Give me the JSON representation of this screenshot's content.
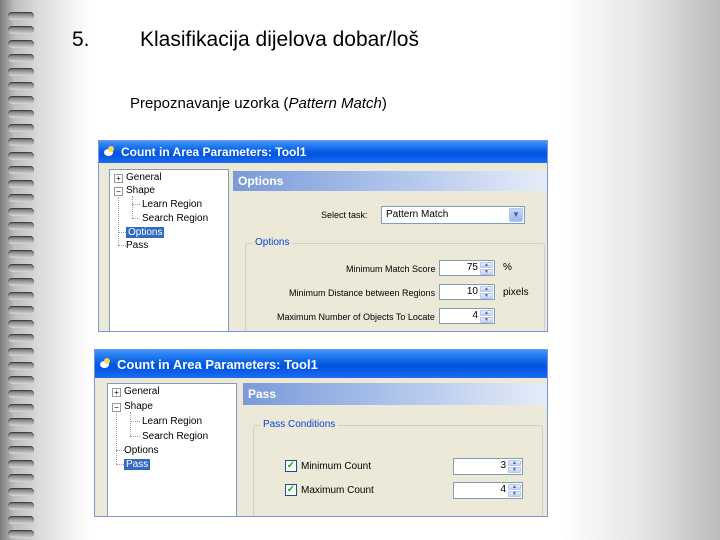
{
  "slide": {
    "number": "5.",
    "title": "Klasifikacija dijelova dobar/loš",
    "subtitle_prefix": "Prepoznavanje uzorka (",
    "subtitle_italic": "Pattern Match",
    "subtitle_suffix": ")"
  },
  "window1": {
    "title": "Count in Area Parameters: Tool1",
    "tree": {
      "general": "General",
      "shape": "Shape",
      "learn_region": "Learn Region",
      "search_region": "Search Region",
      "options": "Options",
      "pass": "Pass",
      "expand_glyph": "+",
      "collapse_glyph": "−"
    },
    "panel_title": "Options",
    "select_task_label": "Select task:",
    "select_task_value": "Pattern Match",
    "group_label": "Options",
    "fields": [
      {
        "label": "Minimum Match Score",
        "value": "75",
        "unit": "%"
      },
      {
        "label": "Minimum Distance between Regions",
        "value": "10",
        "unit": "pixels"
      },
      {
        "label": "Maximum Number of Objects To Locate",
        "value": "4",
        "unit": ""
      }
    ]
  },
  "window2": {
    "title": "Count in Area Parameters: Tool1",
    "tree": {
      "general": "General",
      "shape": "Shape",
      "learn_region": "Learn Region",
      "search_region": "Search Region",
      "options": "Options",
      "pass": "Pass",
      "expand_glyph": "+",
      "collapse_glyph": "−"
    },
    "panel_title": "Pass",
    "group_label": "Pass Conditions",
    "conditions": [
      {
        "label": "Minimum Count",
        "value": "3",
        "checked": true
      },
      {
        "label": "Maximum Count",
        "value": "4",
        "checked": true
      }
    ]
  },
  "glyphs": {
    "check": "✓",
    "spin_up": "▲",
    "spin_down": "▼",
    "dropdown": "▼"
  },
  "icons": [
    "binder-hole-icon",
    "app-window-icon",
    "tree-expand-icon",
    "tree-collapse-icon",
    "checkbox-check-icon",
    "spin-arrow-icon",
    "dropdown-arrow-icon"
  ],
  "colors": {
    "titlebar": "#0054e3",
    "selection": "#316ac5",
    "group_label": "#0046d5",
    "panel_header": "#7a9ad8",
    "dialog_bg": "#ece9d8"
  }
}
